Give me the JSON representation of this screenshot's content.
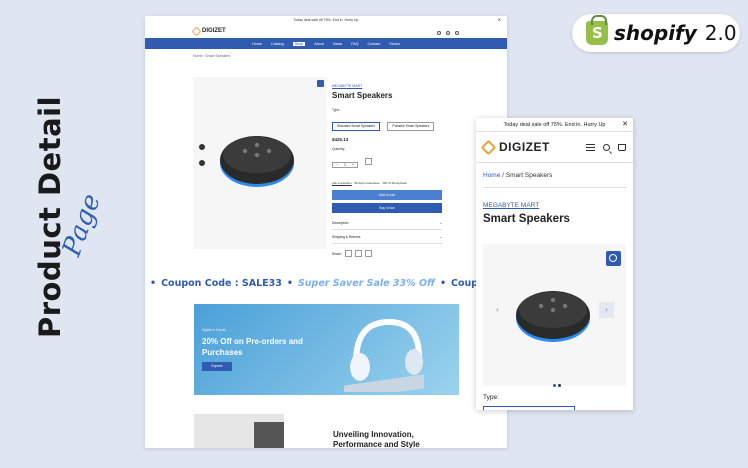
{
  "side_title": {
    "main": "Product Detail",
    "script": "Page"
  },
  "badge": {
    "brand": "shopify",
    "version": "2.0",
    "bag_letter": "S"
  },
  "desktop": {
    "announcement": "Today deal sale off 75%. End in. Hurry Up",
    "logo": "DIGIZET",
    "nav": [
      "Home",
      "Catalog",
      "Shop",
      "About",
      "News",
      "FAQ",
      "Contact",
      "Stores"
    ],
    "nav_active": "Shop",
    "breadcrumb": "Home / Smart Speakers",
    "product": {
      "brand": "MEGABYTE MART",
      "title": "Smart Speakers",
      "type_label": "Type:",
      "options": [
        "Standard Smart Speakers",
        "Portable Smart Speakers"
      ],
      "price": "$425.13",
      "qty_label": "Quantity:",
      "qty_value": "1",
      "meta": [
        "Ask a question",
        "90 days Guarantee",
        "100 % Moneyback"
      ],
      "add_to_cart": "Add to cart",
      "buy_now": "Buy it now",
      "accordions": [
        "Description",
        "Shipping & Returns"
      ],
      "share_label": "Share:"
    },
    "marquee": {
      "coupon": "Coupon Code : SALE33",
      "sale": "Super Saver Sale 33% Off"
    },
    "banner": {
      "small": "Digital In Trends",
      "headline": "20% Off on Pre-orders and Purchases",
      "button": "Explore"
    },
    "promo": {
      "headline": "Unveiling Innovation, Performance and Style"
    }
  },
  "mobile": {
    "announcement": "Today deal sale off 75%. End in. Hurry Up",
    "logo": "DIGIZET",
    "breadcrumb_home": "Home",
    "breadcrumb_current": "Smart Speakers",
    "brand": "MEGABYTE MART",
    "title": "Smart Speakers",
    "type_label": "Type:"
  },
  "colors": {
    "primary": "#2f5bb0",
    "accent": "#4a7fd1",
    "background": "#dfe5f1",
    "shopify": "#95bf47"
  }
}
